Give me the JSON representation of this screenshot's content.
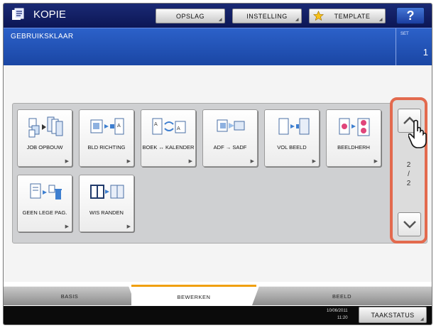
{
  "header": {
    "title": "KOPIE",
    "buttons": {
      "opslag": "OPSLAG",
      "instelling": "INSTELLING",
      "template": "TEMPLATE",
      "help": "?"
    },
    "icons": {
      "app": "copier-icon",
      "template": "star-icon"
    }
  },
  "status": {
    "message": "GEBRUIKSKLAAR",
    "set_label": "SET",
    "set_value": "1"
  },
  "functions": [
    {
      "label": "JOB OPBOUW",
      "icon": "job-build-icon"
    },
    {
      "label": "BLD RICHTING",
      "icon": "image-direction-icon"
    },
    {
      "label": "BOEK ↔ KALENDER",
      "icon": "book-calendar-icon"
    },
    {
      "label": "ADF → SADF",
      "icon": "adf-sadf-icon"
    },
    {
      "label": "VOL BEELD",
      "icon": "full-image-icon"
    },
    {
      "label": "BEELDHERH",
      "icon": "image-repeat-icon"
    },
    {
      "label": "GEEN LEGE PAG.",
      "icon": "blank-page-skip-icon"
    },
    {
      "label": "WIS RANDEN",
      "icon": "edge-erase-icon"
    }
  ],
  "pager": {
    "current": "2",
    "total": "2",
    "separator": "/"
  },
  "tabs": [
    {
      "label": "BASIS",
      "active": false
    },
    {
      "label": "BEWERKEN",
      "active": true
    },
    {
      "label": "BEELD",
      "active": false
    }
  ],
  "footer": {
    "date": "10/06/2011",
    "time": "11:20",
    "job_status": "TAAKSTATUS"
  },
  "colors": {
    "header_dark": "#0c1655",
    "status_blue": "#2c61c9",
    "highlight": "#e36a4e",
    "active_tab_accent": "#f0a010"
  }
}
